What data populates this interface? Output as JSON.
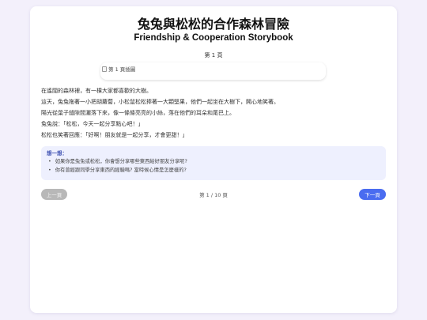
{
  "book": {
    "title": "兔兔與松松的合作森林冒險",
    "subtitle": "Friendship & Cooperation Storybook"
  },
  "page": {
    "page_label": "第 1 頁",
    "illustration_alt": "第 1 頁插圖",
    "story_lines": [
      "在遙闊的森林裡，有一棵大家都喜歡的大樹。",
      "這天，兔兔拖著一小把胡蘿蔔，小松鼠松松捧著一大顆堅果，他們一起坐在大樹下，開心地笑著。",
      "陽光從葉子縫隙間灑落下來，像一條條亮亮的小絲，落在他們的耳朵和尾巴上。",
      "兔兔說：「松松，今天一起分享點心吧！」",
      "松松也笑著回應：「好啊！朋友就是一起分享，才會更甜！」"
    ]
  },
  "think": {
    "title": "想一想：",
    "questions": [
      "如果你是兔兔或松松，你會想分享哪些東西給好朋友分享呢?",
      "你有曾經跟同學分享東西的經驗嗎? 當時候心情是怎麼樣的?"
    ]
  },
  "navigation": {
    "prev_label": "上一頁",
    "next_label": "下一頁",
    "indicator": "第 1 / 10 頁"
  },
  "colors": {
    "background": "#f3f0fb",
    "accent": "#4a6cf0",
    "think_box_bg": "#eef0fe",
    "think_title": "#3a4db0",
    "disabled_button": "#b8b8b8"
  },
  "icons": {
    "illustration_placeholder": "broken-image-icon"
  }
}
